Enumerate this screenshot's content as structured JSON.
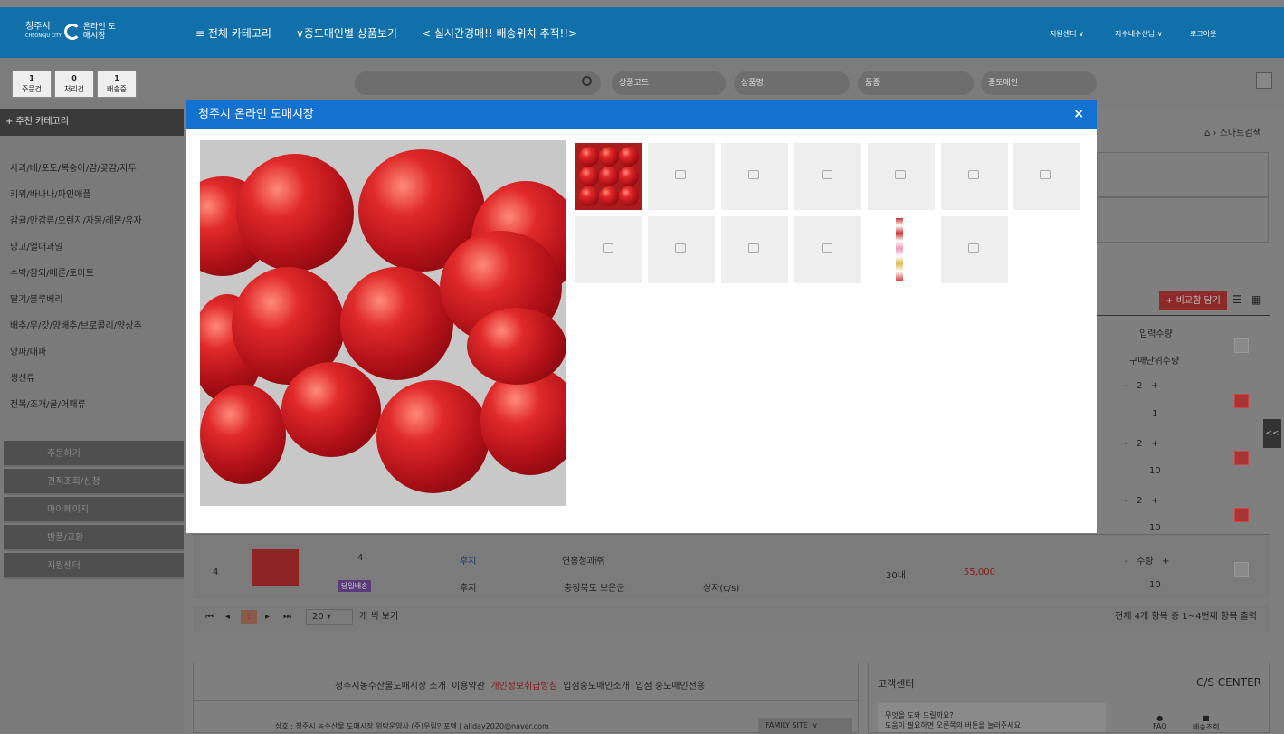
{
  "header": {
    "logo_line1": "청주시",
    "logo_line2": "온라인 도매시장",
    "logo_small": "CHEONGJU CITY",
    "nav": [
      "≡ 전체 카테고리",
      "∨중도매인별 상품보기",
      "< 실시간경매!! 배송위치 추적!!>"
    ],
    "support": "지원센터 ∨",
    "user": "지수네수산님 ∨",
    "logout": "로그아웃"
  },
  "counters": [
    {
      "num": "1",
      "label": "주문건"
    },
    {
      "num": "0",
      "label": "처리건"
    },
    {
      "num": "1",
      "label": "배송중"
    }
  ],
  "search": {
    "placeholder": "",
    "fields": [
      "상품코드",
      "상품명",
      "품종",
      "중도매인"
    ]
  },
  "sidebar": {
    "header": "+ 추천 카테고리",
    "categories": [
      "사과/배/포도/복숭아/감/곶감/자두",
      "키위/바나나/파인애플",
      "감귤/만감류/오렌지/자몽/레몬/유자",
      "망고/열대과일",
      "수박/참외/메론/토마토",
      "딸기/블루베리",
      "배추/무/갓/양배추/브로콜리/양상추",
      "양파/대파",
      "생선류",
      "전복/조개/굴/어패류"
    ],
    "menu": [
      "주문하기",
      "견적조회/신청",
      "마이페이지",
      "반품/교환",
      "지원센터"
    ]
  },
  "breadcrumb": {
    "home_icon": "home-icon",
    "current": "스마트검색"
  },
  "compare_button": "+ 비교함 담기",
  "table_head": {
    "qty_input": "입력수량",
    "unit_qty": "구매단위수량"
  },
  "qty_rows": [
    {
      "value": "2",
      "unit": "1"
    },
    {
      "value": "2",
      "unit": "10"
    },
    {
      "value": "2",
      "unit": "10"
    }
  ],
  "table_row": {
    "no": "4",
    "code": "4",
    "badge": "당일배송",
    "variety1": "후지",
    "variety2": "후지",
    "seller": "연흥청과㈜",
    "origin": "충청북도 보은군",
    "pack": "상자(c/s)",
    "count": "30내",
    "price": "55,000",
    "qty_placeholder": "수량",
    "unit": "10"
  },
  "pager": {
    "page": "1",
    "per_page": "20",
    "per_page_suffix": "개 씩 보기",
    "summary": "전체 4개 항목 중 1~4번째 항목 출력"
  },
  "footer": {
    "links": [
      "청주시농수산물도매시장 소개",
      "이용약관",
      "개인정보취급방침",
      "입점중도매인소개",
      "입점 중도매인전용"
    ],
    "company": "상호 : 청주시 농수산물 도매시장 위탁운영사 (주)우림인포텍 | allday2020@naver.com",
    "family_site": "FAMILY SITE",
    "cs_title": "고객센터",
    "cs_title_en": "C/S CENTER",
    "cs_q": "무엇을 도와 드릴까요?",
    "cs_desc": "도움이 필요하면 오른쪽의 버튼을 눌러주세요.",
    "faq": "FAQ",
    "delivery": "배송조회"
  },
  "modal": {
    "title": "청주시 온라인 도매시장",
    "close": "×"
  },
  "colors": {
    "header_blue": "#1170a9",
    "modal_blue": "#1372d0",
    "accent_red": "#e0262a"
  }
}
